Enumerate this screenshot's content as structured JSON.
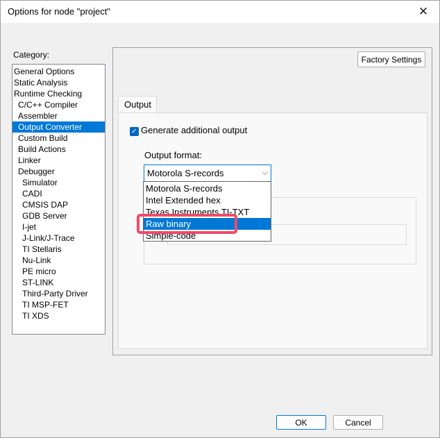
{
  "window": {
    "title": "Options for node \"project\"",
    "close_glyph": "✕"
  },
  "category": {
    "label": "Category:",
    "items": [
      {
        "label": "General Options",
        "level": 0
      },
      {
        "label": "Static Analysis",
        "level": 0
      },
      {
        "label": "Runtime Checking",
        "level": 0
      },
      {
        "label": "C/C++ Compiler",
        "level": 1
      },
      {
        "label": "Assembler",
        "level": 1
      },
      {
        "label": "Output Converter",
        "level": 1,
        "selected": true
      },
      {
        "label": "Custom Build",
        "level": 1
      },
      {
        "label": "Build Actions",
        "level": 1
      },
      {
        "label": "Linker",
        "level": 1
      },
      {
        "label": "Debugger",
        "level": 1
      },
      {
        "label": "Simulator",
        "level": 2
      },
      {
        "label": "CADI",
        "level": 2
      },
      {
        "label": "CMSIS DAP",
        "level": 2
      },
      {
        "label": "GDB Server",
        "level": 2
      },
      {
        "label": "I-jet",
        "level": 2
      },
      {
        "label": "J-Link/J-Trace",
        "level": 2
      },
      {
        "label": "TI Stellaris",
        "level": 2
      },
      {
        "label": "Nu-Link",
        "level": 2
      },
      {
        "label": "PE micro",
        "level": 2
      },
      {
        "label": "ST-LINK",
        "level": 2
      },
      {
        "label": "Third-Party Driver",
        "level": 2
      },
      {
        "label": "TI MSP-FET",
        "level": 2
      },
      {
        "label": "TI XDS",
        "level": 2
      }
    ]
  },
  "panel": {
    "factory_button": "Factory Settings",
    "tab_label": "Output",
    "generate_checkbox": {
      "label": "Generate additional output",
      "checked": true,
      "check_glyph": "✓"
    },
    "format_label": "Output format:",
    "format_value": "Motorola S-records",
    "combo_arrow": "⌵",
    "format_options": [
      {
        "label": "Motorola S-records",
        "selected": false
      },
      {
        "label": "Intel Extended hex",
        "selected": false
      },
      {
        "label": "Texas Instruments TI-TXT",
        "selected": false
      },
      {
        "label": "Raw binary",
        "selected": true
      },
      {
        "label": "Simple-code",
        "selected": false
      }
    ]
  },
  "footer": {
    "ok_label": "OK",
    "cancel_label": "Cancel"
  },
  "colors": {
    "selection": "#0078d7",
    "highlight": "#ef4a6b"
  }
}
